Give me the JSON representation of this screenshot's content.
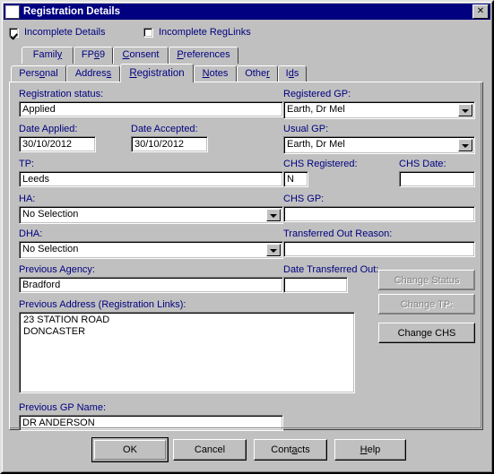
{
  "window": {
    "title": "Registration Details",
    "close_label": "✕",
    "icon": "window-icon"
  },
  "checkboxes": [
    {
      "label": "Incomplete Details",
      "checked": true
    },
    {
      "label": "Incomplete RegLinks",
      "checked": false
    }
  ],
  "tabs_top": [
    {
      "label": "Family",
      "accel": "y",
      "selected": false
    },
    {
      "label": "FP69",
      "accel": "6",
      "selected": false
    },
    {
      "label": "Consent",
      "accel": "C",
      "selected": false
    },
    {
      "label": "Preferences",
      "accel": "P",
      "selected": false
    }
  ],
  "tabs_bottom": [
    {
      "label": "Personal",
      "accel": "o",
      "selected": false
    },
    {
      "label": "Address",
      "accel": "s",
      "selected": false
    },
    {
      "label": "Registration",
      "accel": "R",
      "selected": true
    },
    {
      "label": "Notes",
      "accel": "N",
      "selected": false
    },
    {
      "label": "Other",
      "accel": "r",
      "selected": false
    },
    {
      "label": "Ids",
      "accel": "d",
      "selected": false
    }
  ],
  "form": {
    "registration_status": {
      "label": "Registration status:",
      "value": "Applied"
    },
    "date_applied": {
      "label": "Date Applied:",
      "value": "30/10/2012"
    },
    "date_accepted": {
      "label": "Date Accepted:",
      "value": "30/10/2012"
    },
    "tp": {
      "label": "TP:",
      "value": "Leeds"
    },
    "ha": {
      "label": "HA:",
      "value": "No Selection"
    },
    "dha": {
      "label": "DHA:",
      "value": "No Selection"
    },
    "previous_agency": {
      "label": "Previous Agency:",
      "value": "Bradford"
    },
    "registered_gp": {
      "label": "Registered GP:",
      "value": "Earth, Dr Mel"
    },
    "usual_gp": {
      "label": "Usual GP:",
      "value": "Earth, Dr Mel"
    },
    "chs_registered": {
      "label": "CHS Registered:",
      "value": "N"
    },
    "chs_date": {
      "label": "CHS Date:",
      "value": ""
    },
    "chs_gp": {
      "label": "CHS GP:",
      "value": ""
    },
    "transferred_out_reason": {
      "label": "Transferred Out Reason:",
      "value": ""
    },
    "date_transferred_out": {
      "label": "Date Transferred Out:",
      "value": ""
    },
    "previous_address": {
      "label": "Previous Address (Registration Links):",
      "value": "23 STATION ROAD\nDONCASTER"
    },
    "previous_gp_name": {
      "label": "Previous GP Name:",
      "value": "DR ANDERSON"
    }
  },
  "side_buttons": [
    {
      "label": "Change Status",
      "enabled": false
    },
    {
      "label": "Change TP:",
      "enabled": false
    },
    {
      "label": "Change CHS",
      "enabled": true
    }
  ],
  "bottom_buttons": [
    {
      "label": "OK",
      "accel": "",
      "default": true
    },
    {
      "label": "Cancel",
      "accel": "",
      "default": false
    },
    {
      "label": "Contacts",
      "accel": "a",
      "default": false
    },
    {
      "label": "Help",
      "accel": "H",
      "default": false
    }
  ],
  "colors": {
    "face": "#c0c0c0",
    "title": "#000080",
    "label_text": "#000080",
    "field_bg": "#ffffff",
    "disabled_text": "#808080"
  }
}
